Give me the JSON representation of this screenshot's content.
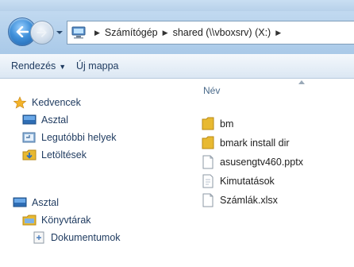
{
  "address": {
    "breadcrumbs": [
      {
        "label": "Számítógép"
      },
      {
        "label": "shared (\\\\vboxsrv) (X:)"
      }
    ]
  },
  "commandbar": {
    "organize_label": "Rendezés",
    "new_folder_label": "Új mappa"
  },
  "navpane": {
    "favorites": {
      "label": "Kedvencek",
      "items": [
        {
          "label": "Asztal",
          "icon": "desktop-icon"
        },
        {
          "label": "Legutóbbi helyek",
          "icon": "recent-places-icon"
        },
        {
          "label": "Letöltések",
          "icon": "downloads-icon"
        }
      ]
    },
    "desktop": {
      "label": "Asztal",
      "children": [
        {
          "label": "Könyvtárak",
          "icon": "libraries-icon"
        },
        {
          "label": "Dokumentumok",
          "icon": "documents-icon"
        }
      ]
    }
  },
  "content": {
    "column_header": "Név",
    "files": [
      {
        "name": "bm",
        "type": "folder"
      },
      {
        "name": "bmark install dir",
        "type": "folder"
      },
      {
        "name": "asusengtv460.pptx",
        "type": "file"
      },
      {
        "name": "Kimutatások",
        "type": "file"
      },
      {
        "name": "Számlák.xlsx",
        "type": "file"
      }
    ]
  },
  "colors": {
    "accent": "#1e3a5f",
    "navbar": "#b7d1ea",
    "folder": "#e8b931"
  }
}
